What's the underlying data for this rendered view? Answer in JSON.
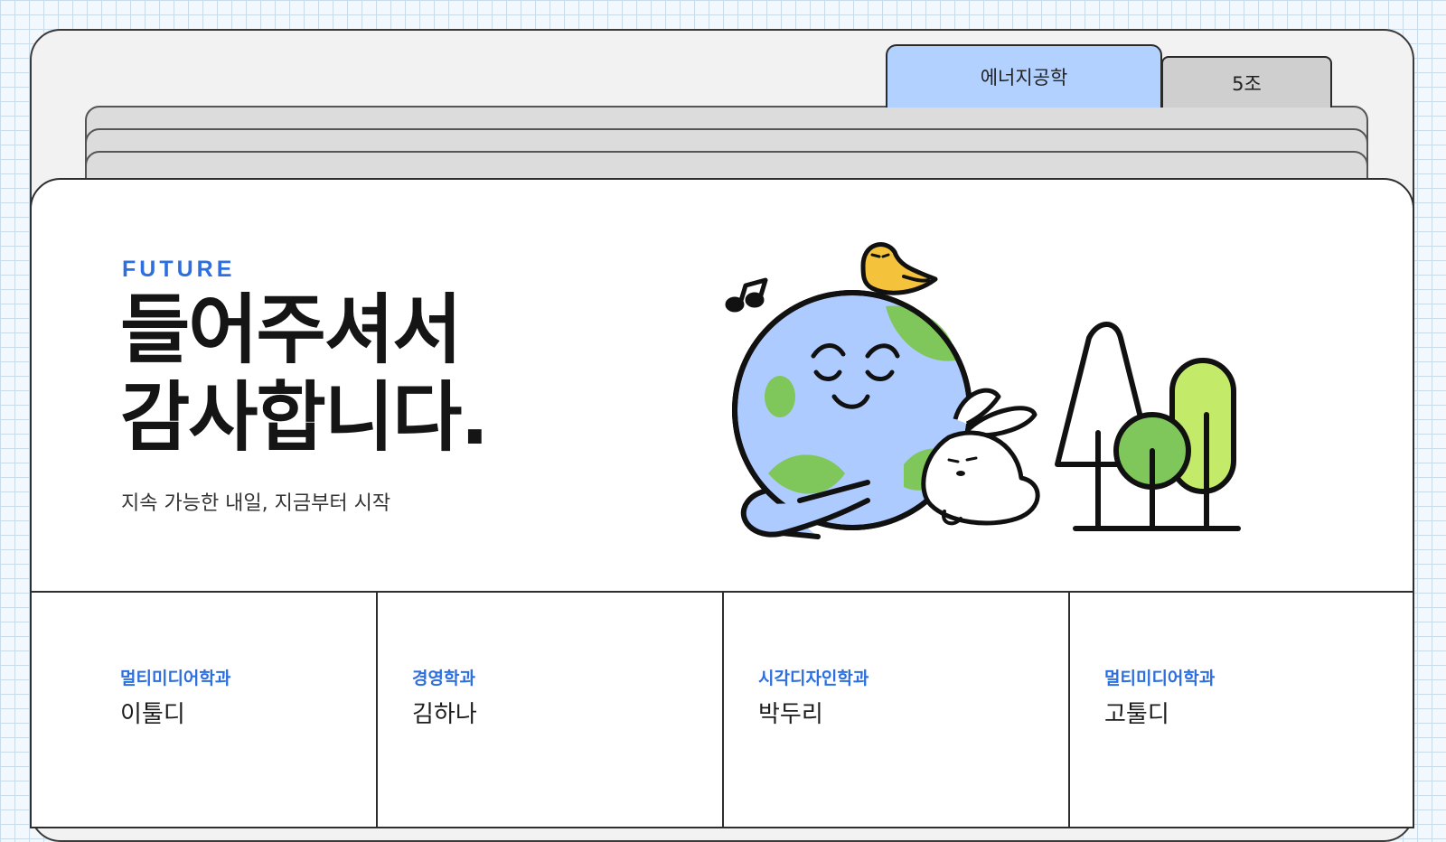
{
  "tabs": {
    "primary_label": "에너지공학",
    "secondary_label": "5조"
  },
  "hero": {
    "eyebrow": "FUTURE",
    "headline_line1": "들어주셔서",
    "headline_line2": "감사합니다.",
    "subtitle": "지속 가능한 내일, 지금부터 시작"
  },
  "members": [
    {
      "dept": "멀티미디어학과",
      "name": "이툴디"
    },
    {
      "dept": "경영학과",
      "name": "김하나"
    },
    {
      "dept": "시각디자인학과",
      "name": "박두리"
    },
    {
      "dept": "멀티미디어학과",
      "name": "고툴디"
    }
  ],
  "colors": {
    "accent": "#2d6fe0",
    "tab_primary": "#b3d1ff",
    "tab_secondary": "#cfcfcf",
    "earth_blue": "#aecbff",
    "earth_green": "#7fc75a",
    "tree_lime": "#c4ea6a",
    "bird_yellow": "#f5c33b"
  },
  "icons": [
    "music-note-icon",
    "earth-character-icon",
    "bird-icon",
    "rabbit-icon",
    "trees-icon"
  ]
}
